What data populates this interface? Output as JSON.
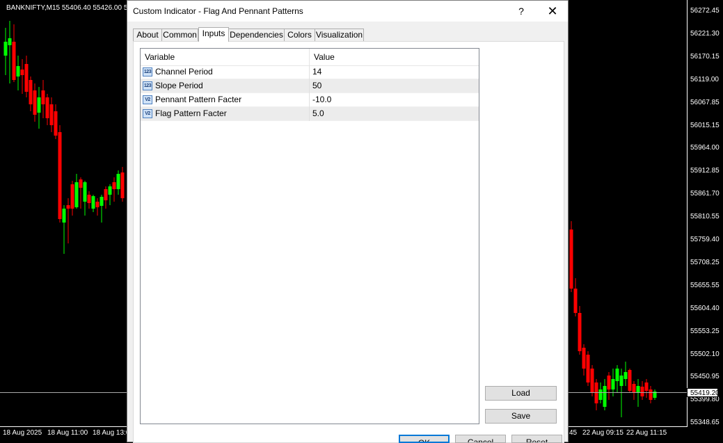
{
  "chart": {
    "title": "BANKNIFTY,M15  55406.40 55426.00 55",
    "current_price": "55419.20",
    "y_ticks": [
      "56272.45",
      "56221.30",
      "56170.15",
      "56119.00",
      "56067.85",
      "56015.15",
      "55964.00",
      "55912.85",
      "55861.70",
      "55810.55",
      "55759.40",
      "55708.25",
      "55655.55",
      "55604.40",
      "55553.25",
      "55502.10",
      "55450.95",
      "55399.80",
      "55348.65"
    ],
    "x_ticks_left": [
      "18 Aug 2025",
      "18 Aug 11:00",
      "18 Aug 13:0"
    ],
    "x_ticks_right": [
      "45",
      "22 Aug 09:15",
      "22 Aug 11:15"
    ],
    "bull_color": "#00ff00",
    "bear_color": "#ff0000"
  },
  "dialog": {
    "title": "Custom Indicator - Flag And Pennant Patterns",
    "help": "?",
    "close": "✕",
    "tabs": [
      "About",
      "Common",
      "Inputs",
      "Dependencies",
      "Colors",
      "Visualization"
    ],
    "active_tab": "Inputs",
    "grid": {
      "columns": [
        "Variable",
        "Value"
      ],
      "rows": [
        {
          "icon": "123",
          "variable": "Channel Period",
          "value": "14"
        },
        {
          "icon": "123",
          "variable": "Slope Period",
          "value": "50"
        },
        {
          "icon": "V2",
          "variable": "Pennant Pattern Facter",
          "value": "-10.0"
        },
        {
          "icon": "V2",
          "variable": "Flag Pattern Facter",
          "value": "5.0"
        }
      ]
    },
    "load_label": "Load",
    "save_label": "Save",
    "ok_label": "OK",
    "cancel_label": "Cancel",
    "reset_label": "Reset"
  }
}
